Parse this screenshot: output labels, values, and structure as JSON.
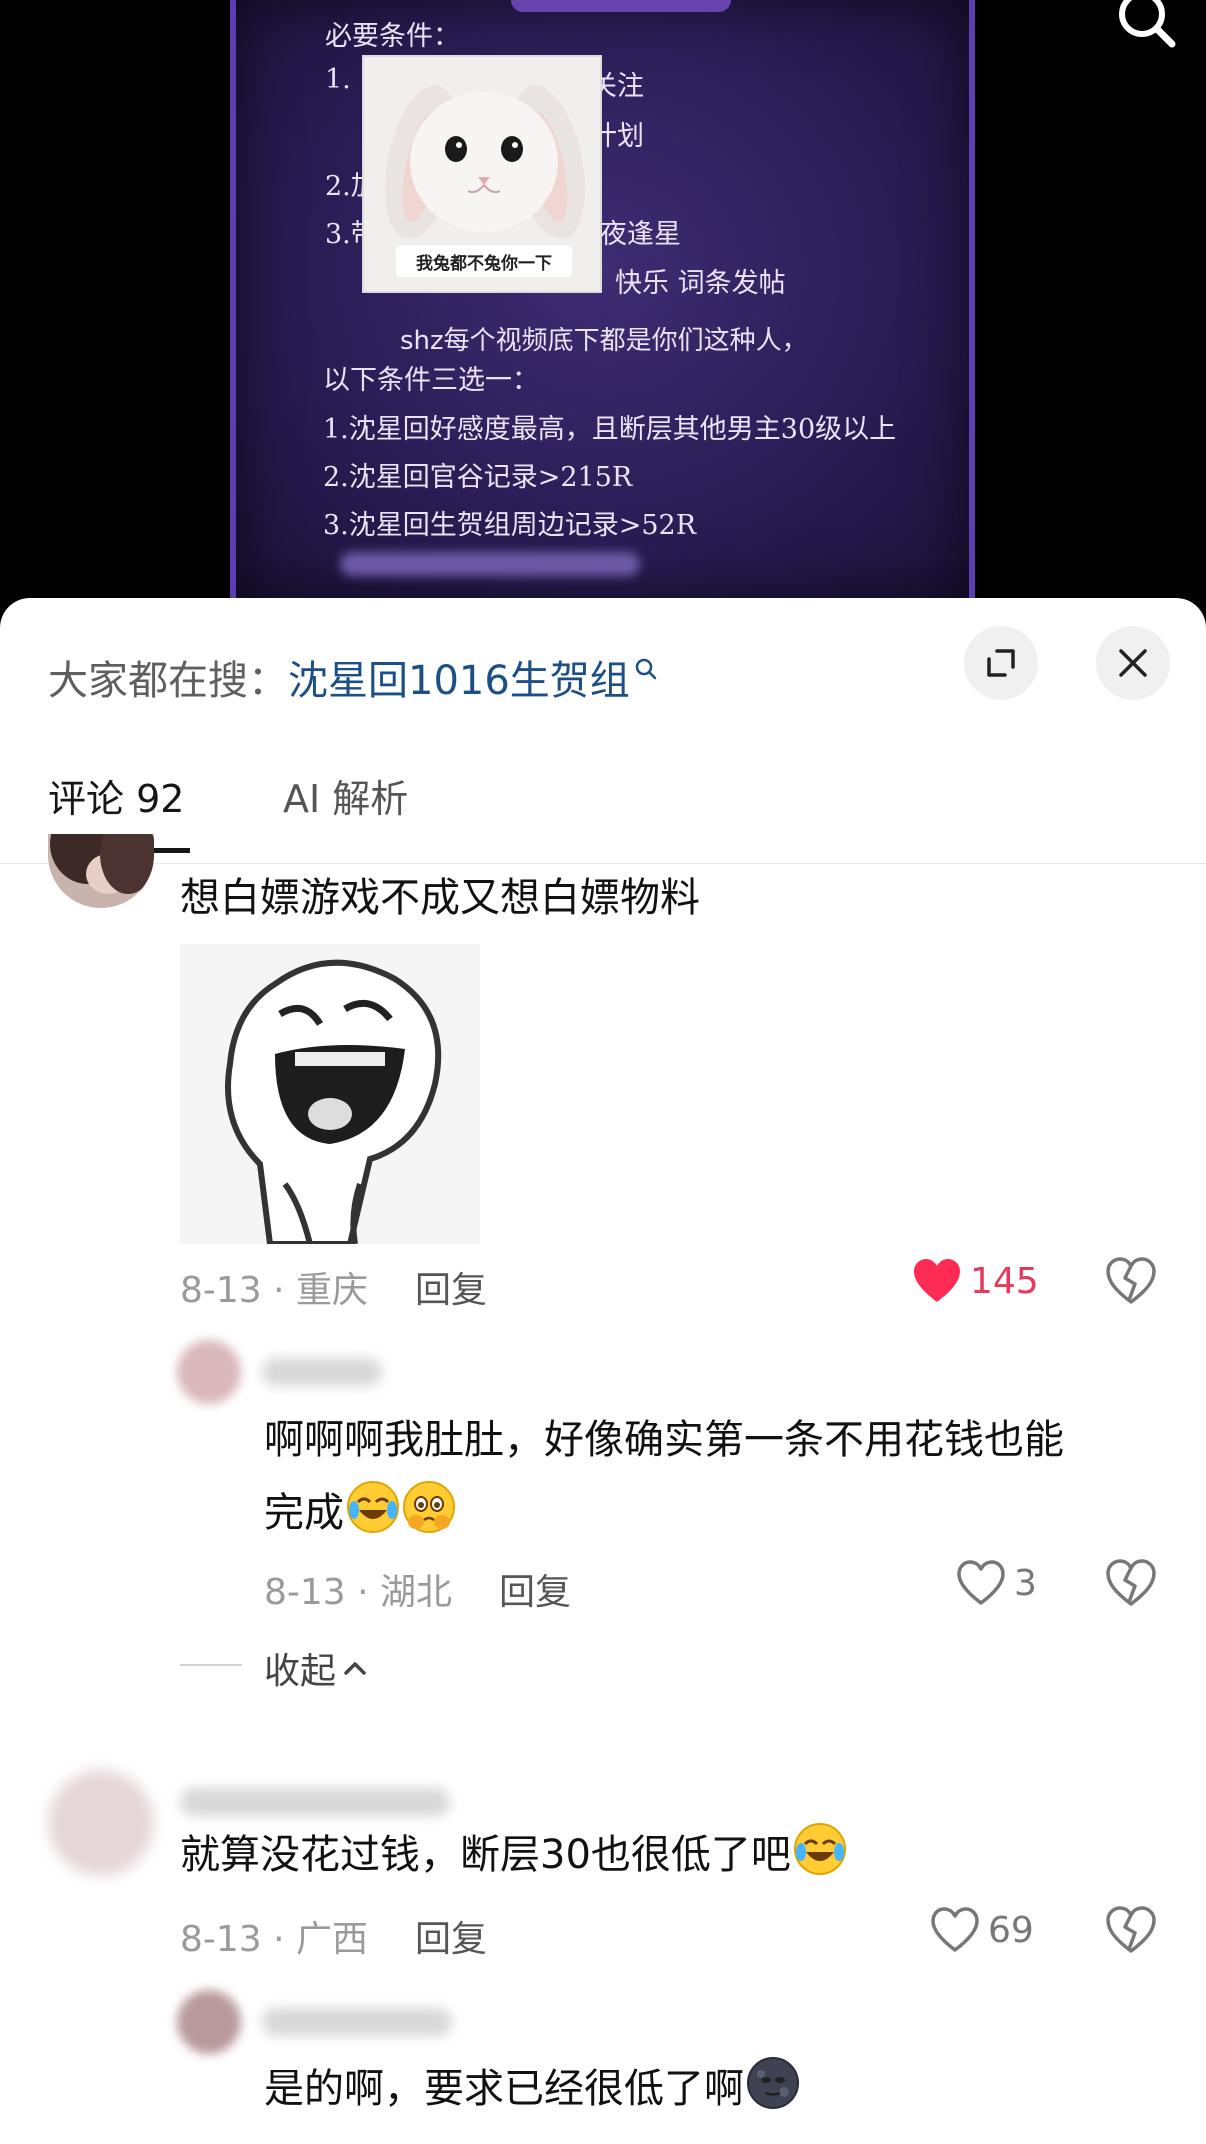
{
  "video": {
    "line_required": "必要条件：",
    "line1": "1.",
    "line1_tail": "关注",
    "line1b_tail": "计划",
    "line2": "2.加",
    "line3": "3.带",
    "line3_tail": "夜逢星",
    "line4_tail": "快乐 词条发帖",
    "line_complaint": "shz每个视频底下都是你们这种人，",
    "line_choose": "以下条件三选一：",
    "cond1": "1.沈星回好感度最高，且断层其他男主30级以上",
    "cond2": "2.沈星回官谷记录>215R",
    "cond3": "3.沈星回生贺组周边记录>52R",
    "sticker_caption": "我兔都不兔你一下"
  },
  "header": {
    "hot_search_label": "大家都在搜：",
    "hot_search_term": "沈星回1016生贺组",
    "expand_icon": "expand-icon",
    "close_icon": "close-icon"
  },
  "tabs": [
    {
      "label": "评论 92",
      "active": true
    },
    {
      "label": "AI 解析",
      "active": false
    }
  ],
  "comments": [
    {
      "text": "想白嫖游戏不成又想白嫖物料",
      "date_location": "8-13 · 重庆",
      "reply_label": "回复",
      "likes": "145",
      "liked": true
    },
    {
      "text_line1": "啊啊啊我肚肚，好像确实第一条不用花钱也能",
      "text_line2": "完成",
      "date_location": "8-13 · 湖北",
      "reply_label": "回复",
      "likes": "3",
      "liked": false
    },
    {
      "text": "就算没花过钱，断层30也很低了吧",
      "date_location": "8-13 · 广西",
      "reply_label": "回复",
      "likes": "69",
      "liked": false
    },
    {
      "text": "是的啊，要求已经很低了啊"
    }
  ],
  "collapse_label": "收起",
  "colors": {
    "accent_like": "#e53a5b",
    "link_blue": "#1b4f86",
    "video_bg": "#2a1d55"
  }
}
